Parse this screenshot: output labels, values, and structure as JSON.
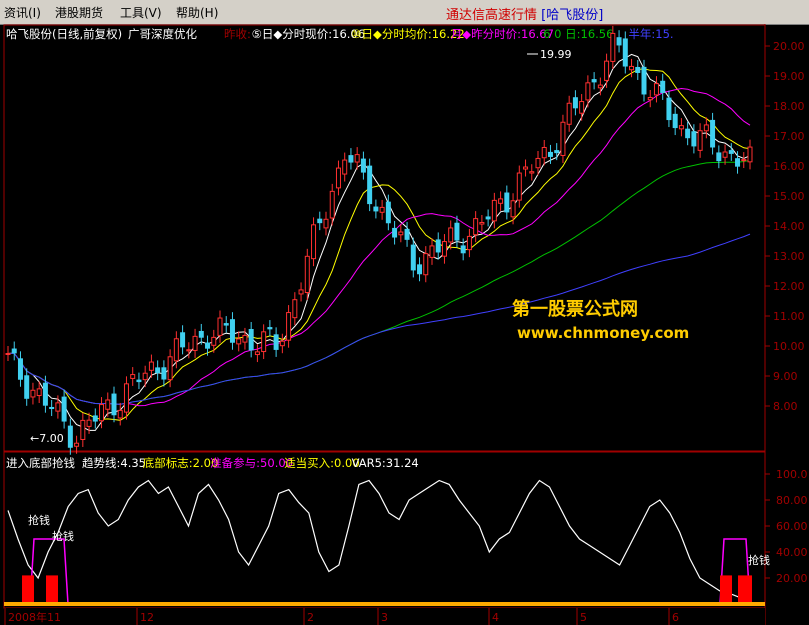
{
  "menubar": {
    "items": [
      "资讯(I)",
      "港股期货",
      "工具(V)",
      "帮助(H)"
    ],
    "title": "通达信高速行情",
    "title_stock": "[哈飞股份]"
  },
  "price_panel": {
    "stock_label": "哈飞股份(日线,前复权)",
    "indicator_label": "广哥深度优化",
    "legend": [
      {
        "text": "昨收:",
        "color": "#a00000"
      },
      {
        "text": "⑤日◆分时现价:16.06",
        "color": "#ffffff"
      },
      {
        "text": "⑩日◆分时均价:16.22",
        "color": "#ffff00"
      },
      {
        "text": "月◆昨分时价:16.67",
        "color": "#ff00ff"
      },
      {
        "text": "6 0 日:16.56",
        "color": "#00c000"
      },
      {
        "text": "半年:15.",
        "color": "#4040ff"
      }
    ],
    "high_label": "19.99",
    "low_label": "←7.00",
    "watermark_line1": "第一股票公式网",
    "watermark_line2": "www.chnmoney.com",
    "y_ticks": [
      "20.00",
      "19.00",
      "18.00",
      "17.00",
      "16.00",
      "15.00",
      "14.00",
      "13.00",
      "12.00",
      "11.00",
      "10.00",
      "9.00",
      "8.00"
    ]
  },
  "indicator_panel": {
    "name": "进入底部抢钱",
    "legend": [
      {
        "text": "趋势线:4.35",
        "color": "#ffffff"
      },
      {
        "text": "底部标志:2.00",
        "color": "#ffff00"
      },
      {
        "text": "准备参与:50.00",
        "color": "#ff00ff"
      },
      {
        "text": "适当买入:0.00",
        "color": "#ffff00"
      },
      {
        "text": "VAR5:31.24",
        "color": "#ffffff"
      }
    ],
    "signal_label": "抢钱",
    "y_ticks": [
      "100.0",
      "80.00",
      "60.00",
      "40.00",
      "20.00"
    ]
  },
  "x_axis": {
    "labels": [
      "2008年11",
      "12",
      "2",
      "3",
      "4",
      "5",
      "6"
    ]
  },
  "chart_data": {
    "type": "line",
    "title": "哈飞股份(日线,前复权)",
    "price_ylim": [
      7.0,
      20.5
    ],
    "indicator_ylim": [
      0,
      105
    ],
    "price_close_key_points": [
      {
        "x": "2008-11",
        "y": 9.5
      },
      {
        "x": "2008-11",
        "y": 7.0
      },
      {
        "x": "2008-12",
        "y": 9.0
      },
      {
        "x": "2008-12",
        "y": 10.5
      },
      {
        "x": "2009-01",
        "y": 10.0
      },
      {
        "x": "2009-02",
        "y": 16.5
      },
      {
        "x": "2009-03",
        "y": 12.8
      },
      {
        "x": "2009-03",
        "y": 14.0
      },
      {
        "x": "2009-04",
        "y": 16.5
      },
      {
        "x": "2009-04",
        "y": 19.99
      },
      {
        "x": "2009-05",
        "y": 17.2
      },
      {
        "x": "2009-06",
        "y": 16.06
      }
    ],
    "series": [
      {
        "name": "趋势线",
        "color": "#ffffff",
        "values": [
          72,
          50,
          30,
          20,
          40,
          55,
          75,
          85,
          88,
          70,
          60,
          65,
          80,
          90,
          95,
          85,
          90,
          75,
          60,
          85,
          92,
          80,
          65,
          40,
          30,
          45,
          60,
          85,
          88,
          78,
          70,
          40,
          25,
          30,
          60,
          92,
          95,
          85,
          70,
          65,
          80,
          85,
          90,
          95,
          92,
          80,
          70,
          60,
          40,
          50,
          55,
          70,
          85,
          95,
          90,
          75,
          60,
          50,
          45,
          40,
          35,
          30,
          45,
          60,
          75,
          80,
          70,
          55,
          35,
          20,
          15,
          10,
          8,
          5,
          4.35
        ]
      },
      {
        "name": "准备参与",
        "color": "#ff00ff"
      },
      {
        "name": "适当买入",
        "color": "#ffff00"
      }
    ]
  }
}
